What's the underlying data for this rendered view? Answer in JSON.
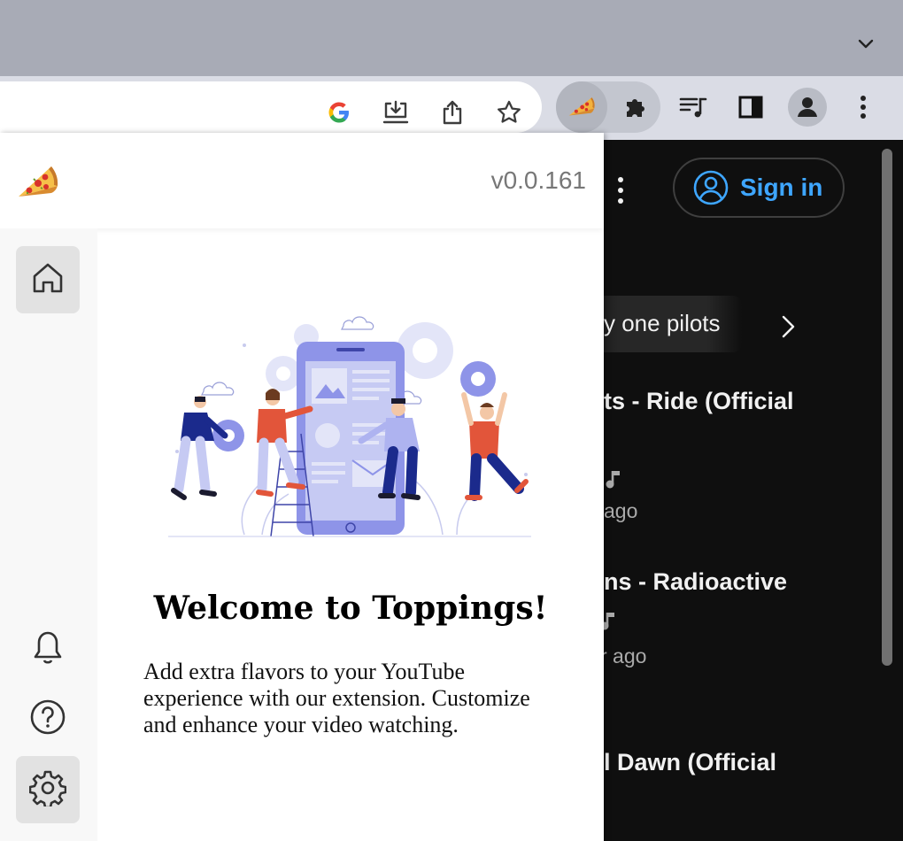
{
  "browser": {
    "toolbar_icons": [
      "google-icon",
      "install-app-icon",
      "share-icon",
      "bookmark-star-icon",
      "toppings-extension-icon",
      "extensions-puzzle-icon",
      "media-queue-icon",
      "side-panel-icon",
      "profile-avatar-icon",
      "chrome-menu-icon"
    ]
  },
  "popup": {
    "version": "v0.0.161",
    "sidebar": {
      "items": [
        "home",
        "notifications",
        "help",
        "settings"
      ]
    },
    "welcome_title": "Welcome to Toppings!",
    "welcome_text": "Add extra flavors to your YouTube experience with our extension. Customize and enhance your video watching."
  },
  "youtube": {
    "sign_in_label": "Sign in",
    "chip_label": "y one pilots",
    "videos": [
      {
        "title": "ts - Ride (Official",
        "meta": "ago"
      },
      {
        "title": "ns - Radioactive",
        "meta": "r ago"
      },
      {
        "title": "l Dawn (Official",
        "meta": ""
      }
    ]
  },
  "colors": {
    "accent_link": "#3ea6ff",
    "popup_bg": "#ffffff",
    "youtube_bg": "#0f0f0f",
    "illustration_purple": "#8e94e8",
    "illustration_orange": "#e2553a",
    "illustration_navy": "#1b2a8c"
  }
}
